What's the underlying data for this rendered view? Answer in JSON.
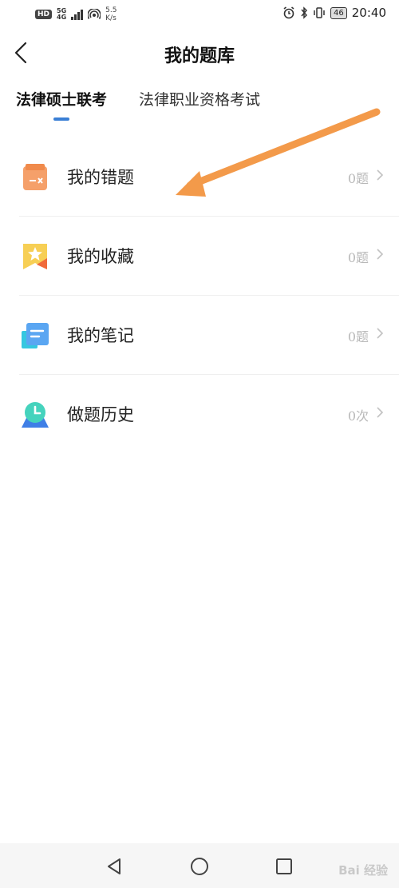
{
  "status_bar": {
    "hd": "HD",
    "net_top": "5G",
    "net_bottom": "4G",
    "speed_value": "5.5",
    "speed_unit": "K/s",
    "battery": "46",
    "time": "20:40"
  },
  "header": {
    "title": "我的题库"
  },
  "tabs": [
    {
      "label": "法律硕士联考",
      "active": true
    },
    {
      "label": "法律职业资格考试",
      "active": false
    }
  ],
  "items": [
    {
      "label": "我的错题",
      "count": "0题",
      "icon": "wrong-questions-icon",
      "color": "#f08a4b"
    },
    {
      "label": "我的收藏",
      "count": "0题",
      "icon": "favorites-icon",
      "color": "#f5c94c"
    },
    {
      "label": "我的笔记",
      "count": "0题",
      "icon": "notes-icon",
      "color": "#4a9ff0"
    },
    {
      "label": "做题历史",
      "count": "0次",
      "icon": "history-clock-icon",
      "color": "#3ed1b8"
    }
  ],
  "annotation": {
    "arrow_color": "#f39a4a"
  },
  "watermark": "Bai 经验"
}
